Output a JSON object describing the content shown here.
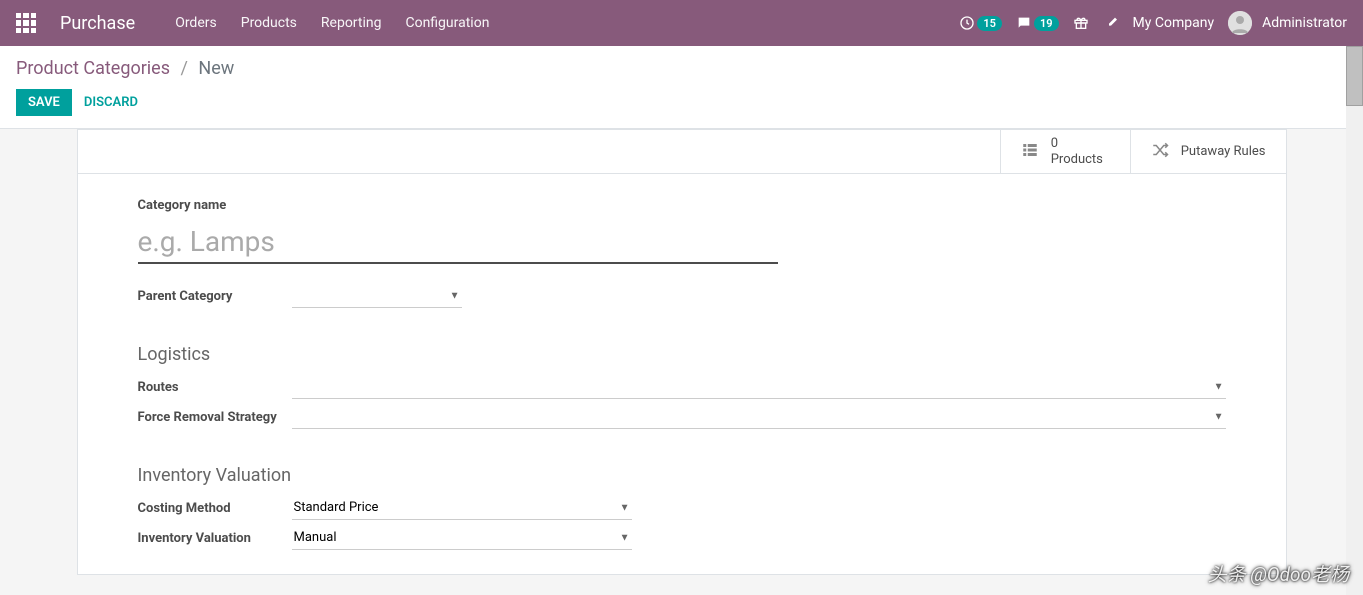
{
  "navbar": {
    "brand": "Purchase",
    "menu": [
      "Orders",
      "Products",
      "Reporting",
      "Configuration"
    ],
    "clock_badge": "15",
    "chat_badge": "19",
    "company": "My Company",
    "user": "Administrator"
  },
  "breadcrumb": {
    "parent": "Product Categories",
    "current": "New"
  },
  "buttons": {
    "save": "SAVE",
    "discard": "DISCARD"
  },
  "stat_buttons": {
    "products_count": "0",
    "products_label": "Products",
    "putaway_label": "Putaway Rules"
  },
  "form": {
    "category_name_label": "Category name",
    "category_name_placeholder": "e.g. Lamps",
    "category_name_value": "",
    "parent_category_label": "Parent Category",
    "parent_category_value": "",
    "logistics_header": "Logistics",
    "routes_label": "Routes",
    "routes_value": "",
    "force_removal_label": "Force Removal Strategy",
    "force_removal_value": "",
    "inventory_header": "Inventory Valuation",
    "costing_method_label": "Costing Method",
    "costing_method_value": "Standard Price",
    "inventory_valuation_label": "Inventory Valuation",
    "inventory_valuation_value": "Manual"
  },
  "watermark": "头条 @Odoo老杨"
}
